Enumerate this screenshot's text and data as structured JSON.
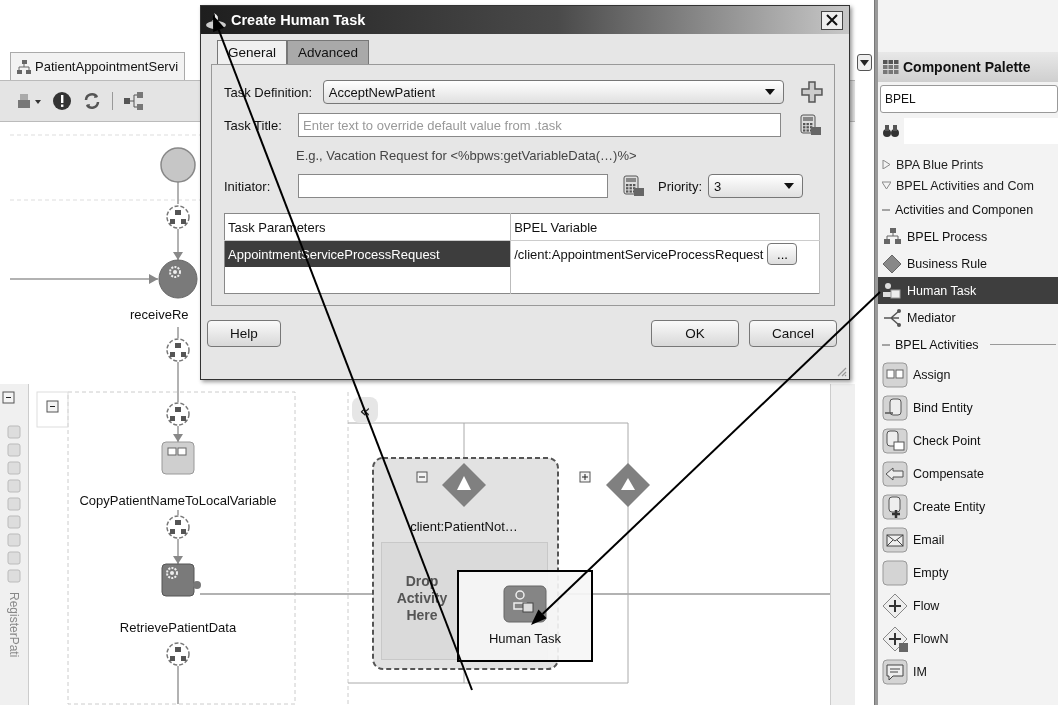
{
  "editor": {
    "tab": {
      "label": "PatientAppointmentServi",
      "selected": true
    },
    "side_label": "RegisterPati",
    "nodes": [
      {
        "kind": "start"
      },
      {
        "kind": "receive",
        "label": "receiveRe"
      },
      {
        "kind": "assign",
        "label": "CopyPatientNameToLocalVariable"
      },
      {
        "kind": "invoke",
        "label": "RetrievePatientData"
      }
    ],
    "collapse_button": "«",
    "handler": {
      "label": "client:PatientNot…",
      "drop_hint": "Drop Activity Here"
    },
    "drag_item": {
      "label": "Human Task"
    }
  },
  "dialog": {
    "title": "Create Human Task",
    "tabs": [
      {
        "label": "General",
        "selected": true
      },
      {
        "label": "Advanced",
        "selected": false
      }
    ],
    "task_definition": {
      "label": "Task Definition:",
      "value": "AcceptNewPatient"
    },
    "task_title": {
      "label": "Task Title:",
      "placeholder": "Enter text to override default value from .task"
    },
    "hint": "E.g., Vacation Request for <%bpws:getVariableData(…)%>",
    "initiator": {
      "label": "Initiator:"
    },
    "priority": {
      "label": "Priority:",
      "value": "3"
    },
    "table": {
      "columns": [
        "Task Parameters",
        "BPEL Variable"
      ],
      "rows": [
        {
          "cells": [
            "AppointmentServiceProcessRequest",
            "/client:AppointmentServiceProcessRequest"
          ],
          "selected": true,
          "action": "..."
        }
      ]
    },
    "buttons": [
      "Help",
      "OK",
      "Cancel"
    ]
  },
  "palette": {
    "title": "Component Palette",
    "category": "BPEL",
    "groups": [
      {
        "label": "BPA Blue Prints",
        "expanded": false
      },
      {
        "label": "BPEL Activities and Com",
        "expanded": true,
        "children": [
          {
            "label": "Activities and Componen",
            "expanded": true,
            "children": [
              {
                "label": "BPEL Process",
                "selected": false
              },
              {
                "label": "Business Rule",
                "selected": false
              },
              {
                "label": "Human Task",
                "selected": true
              },
              {
                "label": "Mediator",
                "selected": false
              }
            ]
          },
          {
            "label": "BPEL Activities",
            "expanded": true,
            "children": [
              {
                "label": "Assign",
                "selected": false
              },
              {
                "label": "Bind Entity",
                "selected": false
              },
              {
                "label": "Check Point",
                "selected": false
              },
              {
                "label": "Compensate",
                "selected": false
              },
              {
                "label": "Create Entity",
                "selected": false
              },
              {
                "label": "Email",
                "selected": false
              },
              {
                "label": "Empty",
                "selected": false
              },
              {
                "label": "Flow",
                "selected": false
              },
              {
                "label": "FlowN",
                "selected": false
              },
              {
                "label": "IM",
                "selected": false
              }
            ]
          }
        ]
      }
    ]
  }
}
